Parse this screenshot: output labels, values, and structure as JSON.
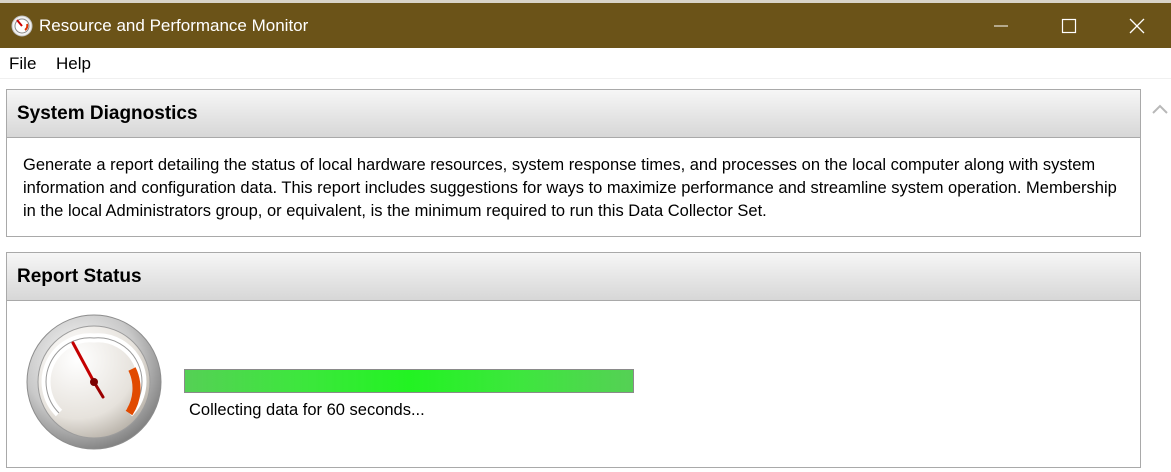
{
  "window": {
    "title": "Resource and Performance Monitor",
    "titlebar_color": "#6b5318"
  },
  "menu": {
    "items": [
      "File",
      "Help"
    ]
  },
  "diagnostics": {
    "title": "System Diagnostics",
    "description": "Generate a report detailing the status of local hardware resources, system response times, and processes on the local computer along with system information and configuration data. This report includes suggestions for ways to maximize performance and streamline system operation. Membership in the local Administrators group, or equivalent, is the minimum required to run this Data Collector Set."
  },
  "report": {
    "title": "Report Status",
    "progress_fraction": 1.0,
    "progress_color": "#22f322",
    "status": "Collecting data for 60 seconds..."
  },
  "icons": {
    "app": "performance-gauge-icon",
    "gauge": "gauge-icon",
    "minimize": "minimize-icon",
    "maximize": "maximize-icon",
    "close": "close-icon",
    "scroll_up": "chevron-up-icon"
  }
}
